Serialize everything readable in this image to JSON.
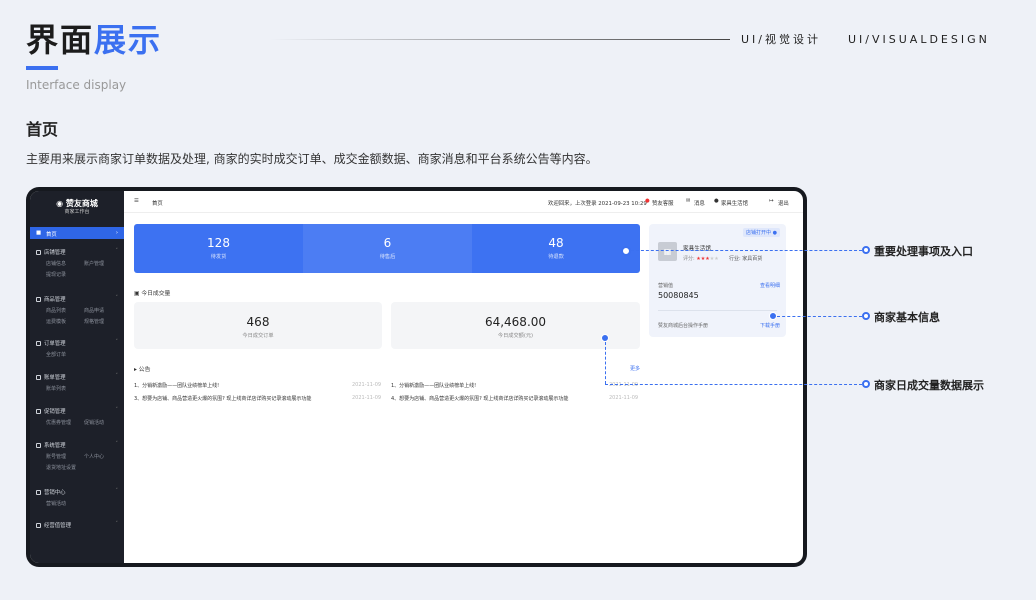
{
  "header": {
    "title_a": "界面",
    "title_b": "展示",
    "subtitle": "Interface display",
    "right_cn": "UI/视觉设计",
    "right_en": "UI/VISUALDESIGN"
  },
  "section": {
    "title": "首页",
    "desc": "主要用来展示商家订单数据及处理, 商家的实时成交订单、成交金额数据、商家消息和平台系统公告等内容。"
  },
  "app": {
    "logo": {
      "name": "赞友商城",
      "sub": "商家工作台"
    },
    "sidebar": {
      "home": "首页",
      "sections": [
        {
          "label": "店铺管理",
          "items": [
            "店铺信息",
            "账户管理",
            "提现记录"
          ]
        },
        {
          "label": "商品管理",
          "items": [
            "商品列表",
            "商品申请",
            "运费模板",
            "规格管理"
          ]
        },
        {
          "label": "订单管理",
          "items": [
            "全部订单"
          ]
        },
        {
          "label": "账单管理",
          "items": [
            "账单列表"
          ]
        },
        {
          "label": "促销管理",
          "items": [
            "优惠券管理",
            "促销活动"
          ]
        },
        {
          "label": "系统管理",
          "items": [
            "账号管理",
            "个人中心",
            "退货地址设置"
          ]
        },
        {
          "label": "营销中心",
          "items": [
            "营销活动"
          ]
        },
        {
          "label": "经营值管理",
          "items": []
        }
      ]
    },
    "topbar": {
      "breadcrumb": "首页",
      "welcome": "欢迎回来，上次登录 2021-09-23 10:29",
      "service": "赞友客服",
      "messages": "消息",
      "shop": "家具生活馆",
      "logout": "退出"
    },
    "stats": [
      {
        "value": "128",
        "label": "待发货"
      },
      {
        "value": "6",
        "label": "待售后"
      },
      {
        "value": "48",
        "label": "待退款"
      }
    ],
    "today": {
      "title": "今日成交量",
      "orders": {
        "value": "468",
        "label": "今日成交订单"
      },
      "amount": {
        "value": "64,468.00",
        "label": "今日成交额(元)"
      }
    },
    "notice": {
      "title": "公告",
      "more": "更多",
      "items": [
        {
          "text": "1、分销新激励——团队业绩榜单上线!",
          "date": "2021-11-09"
        },
        {
          "text": "1、分销新激励——团队业绩榜单上线!",
          "date": "2021-11-09"
        },
        {
          "text": "3、想要为店铺、商品营造更火爆的氛围? 现上线商详店详购买记录滚动展示功能",
          "date": "2021-11-09"
        },
        {
          "text": "4、想要为店铺、商品营造更火爆的氛围? 现上线商详店详购买记录滚动展示功能",
          "date": "2021-11-09"
        }
      ]
    },
    "shop_panel": {
      "status": "店铺打开中",
      "name": "家具生活馆",
      "rating_label": "评分:",
      "industry": "行业: 家具百货",
      "balance_label": "营销值",
      "detail": "查看明细",
      "balance": "50080845",
      "manual_text": "赞友商城后台操作手册",
      "download": "下载手册"
    }
  },
  "annotations": [
    "重要处理事项及入口",
    "商家基本信息",
    "商家日成交量数据展示"
  ]
}
